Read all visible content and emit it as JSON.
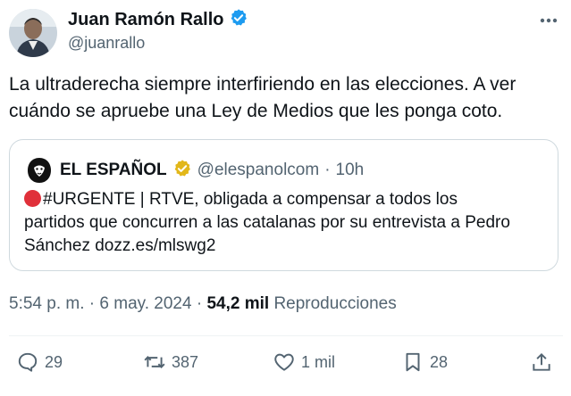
{
  "author": {
    "name": "Juan Ramón Rallo",
    "handle": "@juanrallo",
    "verified_color": "#1d9bf0"
  },
  "tweet": {
    "line1": "La ultraderecha siempre interfiriendo en las elecciones. A ver",
    "line2": "cuándo se apruebe una Ley de Medios que les ponga coto."
  },
  "quote": {
    "name": "EL ESPAÑOL",
    "handle": "@elespanolcom",
    "separator": "·",
    "time": "10h",
    "badge_color": "#e2b719",
    "line1": "#URGENTE | RTVE, obligada a compensar a todos los",
    "line2": "partidos que concurren a las catalanas por su entrevista a Pedro",
    "line3": "Sánchez dozz.es/mlswg2"
  },
  "meta": {
    "time": "5:54 p. m.",
    "sep1": "·",
    "date": "6 may. 2024",
    "sep2": "·",
    "views": "54,2 mil",
    "views_label": "Reproducciones"
  },
  "actions": {
    "replies": "29",
    "retweets": "387",
    "likes": "1 mil",
    "bookmarks": "28"
  },
  "icons": {
    "more": "more-icon",
    "reply": "reply-icon",
    "retweet": "retweet-icon",
    "like": "heart-icon",
    "bookmark": "bookmark-icon",
    "share": "share-icon"
  }
}
